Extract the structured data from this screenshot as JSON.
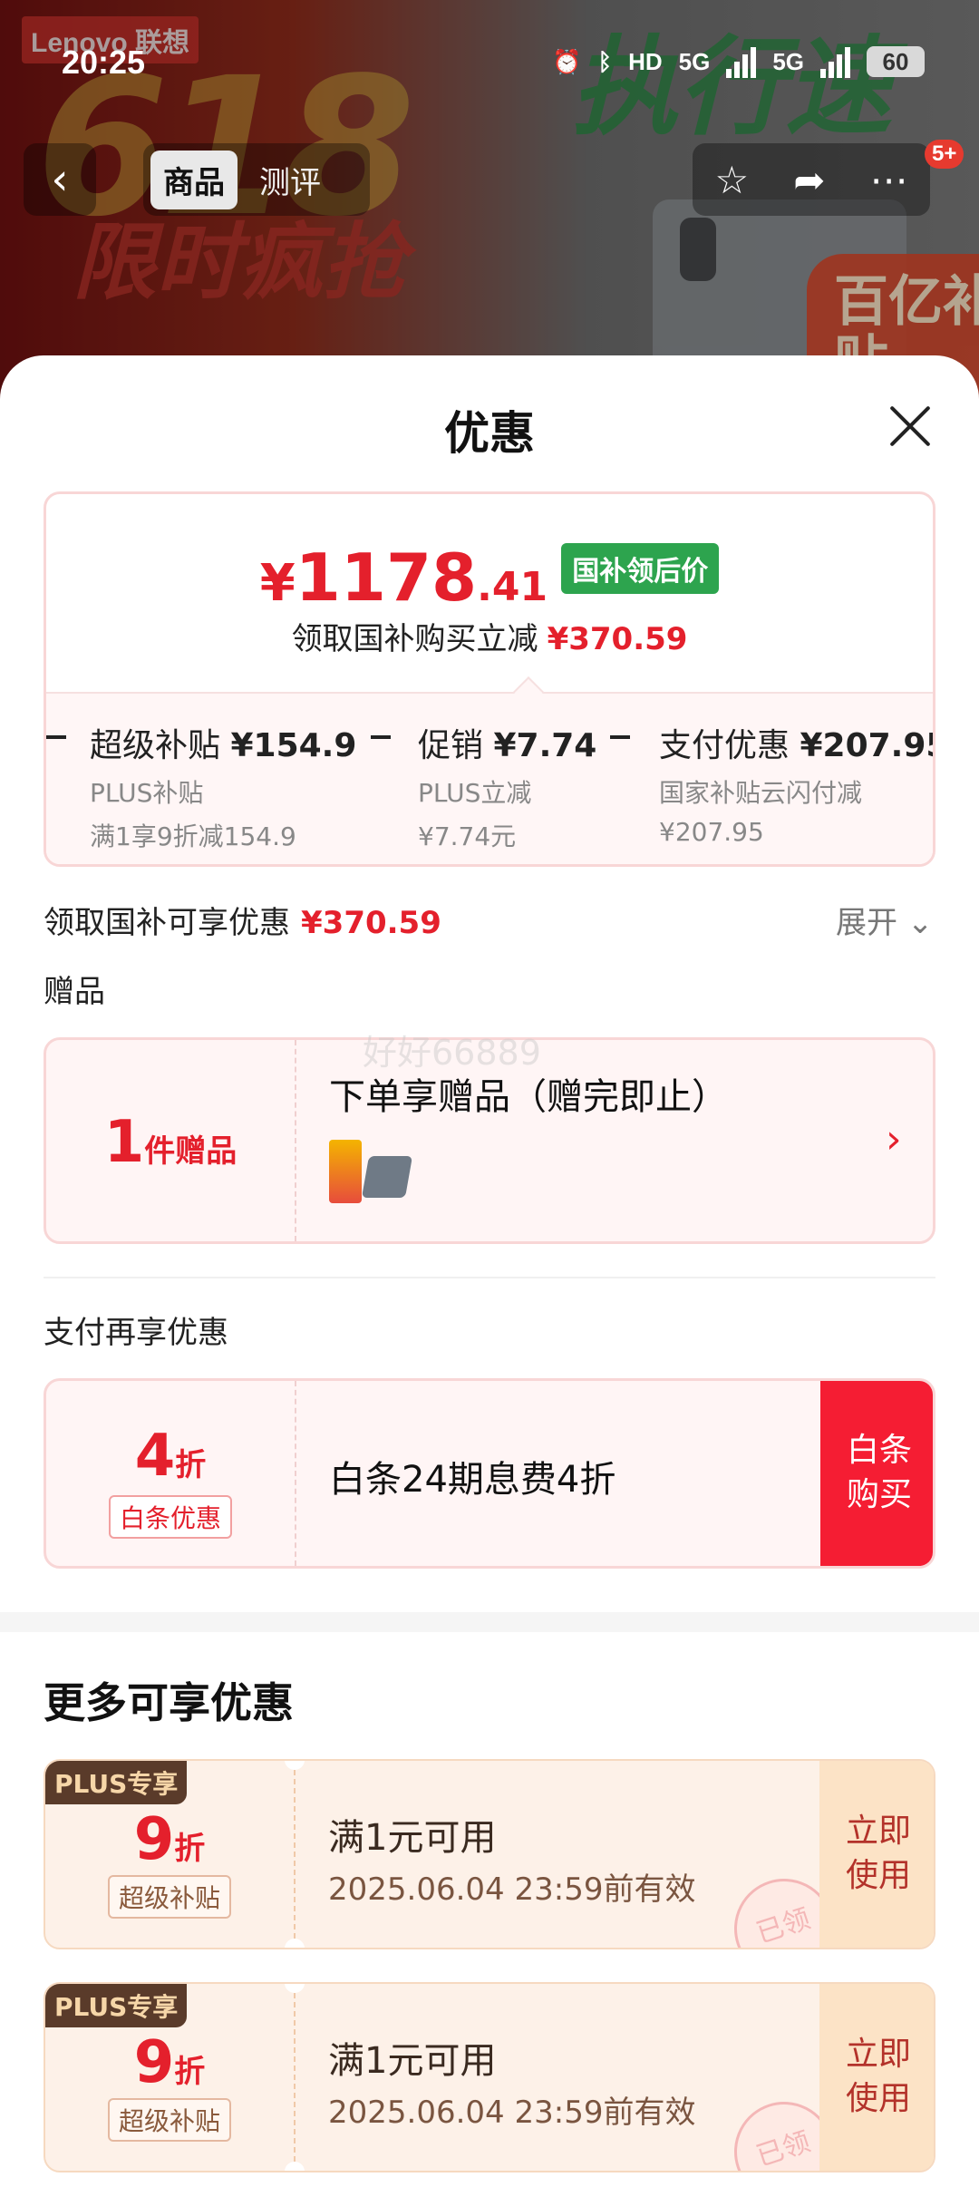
{
  "status_bar": {
    "time": "20:25",
    "hd": "HD",
    "net1": "5G",
    "net2": "5G",
    "battery": "60"
  },
  "background": {
    "brand": "Lenovo 联想",
    "promo": "618",
    "promo_sub": "限时疯抢",
    "slogan": "执行速",
    "subsidy": "百亿补贴"
  },
  "nav": {
    "back_icon": "back-arrow-icon",
    "tabs": [
      {
        "label": "商品",
        "active": true
      },
      {
        "label": "测评",
        "active": false
      }
    ],
    "actions": [
      "star-icon",
      "share-icon",
      "more-icon"
    ],
    "more_badge": "5+"
  },
  "sheet": {
    "title": "优惠",
    "close_icon": "close-icon",
    "price": {
      "yen": "¥",
      "integer": "1178",
      "decimal": ".41",
      "tag": "国补领后价",
      "sub_label": "领取国补购买立减",
      "sub_amount": "¥370.59"
    },
    "discounts": [
      {
        "name": "超级补贴",
        "amount": "¥154.9",
        "line2": "PLUS补贴",
        "line3": "满1享9折减154.9"
      },
      {
        "name": "促销",
        "amount": "¥7.74",
        "line2": "PLUS立减",
        "line3": "¥7.74元"
      },
      {
        "name": "支付优惠",
        "amount": "¥207.95",
        "line2": "国家补贴云闪付减",
        "line3": "¥207.95"
      }
    ],
    "total_label": "领取国补可享优惠",
    "total_amount": "¥370.59",
    "expand_label": "展开",
    "gift_section": "赠品",
    "gift": {
      "count": "1",
      "unit": "件赠品",
      "title": "下单享赠品（赠完即止）"
    },
    "watermark": "好好66889",
    "pay_section": "支付再享优惠",
    "baitiao": {
      "discount": "4",
      "unit": "折",
      "chip": "白条优惠",
      "text": "白条24期息费4折",
      "button": "白条购买"
    },
    "more_title": "更多可享优惠",
    "coupons": [
      {
        "tag": "PLUS专享",
        "discount": "9",
        "unit": "折",
        "chip": "超级补贴",
        "condition": "满1元可用",
        "validity": "2025.06.04 23:59前有效",
        "button": "立即使用",
        "stamp": "已领"
      },
      {
        "tag": "PLUS专享",
        "discount": "9",
        "unit": "折",
        "chip": "超级补贴",
        "condition": "满1元可用",
        "validity": "2025.06.04 23:59前有效",
        "button": "立即使用",
        "stamp": "已领"
      }
    ]
  },
  "colors": {
    "price_red": "#e4202c",
    "tag_green": "#2da44e",
    "buy_red": "#f51d33",
    "coupon_bg": "#fdf1e8"
  }
}
